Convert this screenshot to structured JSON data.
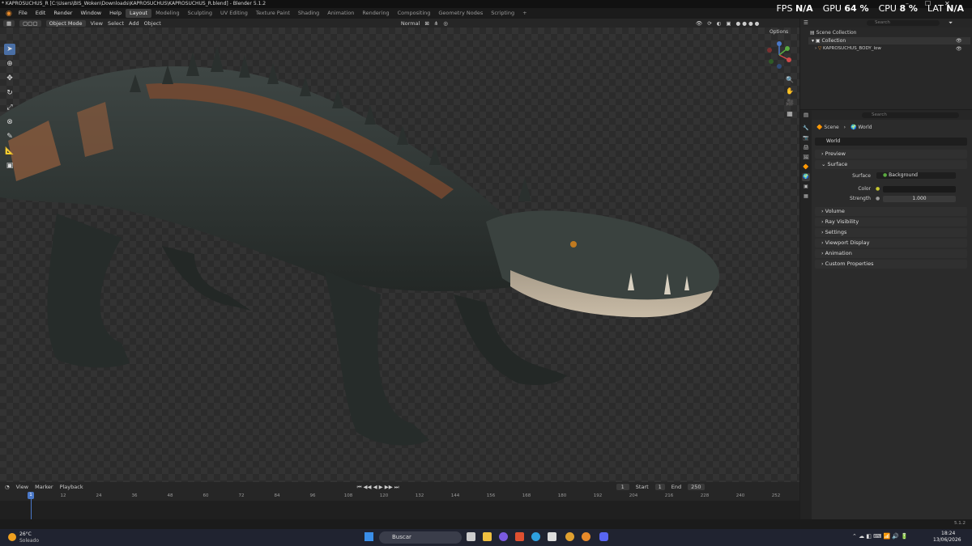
{
  "window": {
    "title": "* KAPROSUCHUS_R [C:\\Users\\BIS_Woken\\Downloads\\KAPROSUCHUS\\KAPROSUCHUS_R.blend] - Blender 5.1.2"
  },
  "menus": [
    "File",
    "Edit",
    "Render",
    "Window",
    "Help"
  ],
  "workspaces": [
    "Layout",
    "Modeling",
    "Sculpting",
    "UV Editing",
    "Texture Paint",
    "Shading",
    "Animation",
    "Rendering",
    "Compositing",
    "Geometry Nodes",
    "Scripting",
    "+"
  ],
  "active_workspace": "Layout",
  "overlay_stats": {
    "fps_label": "FPS",
    "fps_value": "N/A",
    "gpu_label": "GPU",
    "gpu_value": "64 %",
    "cpu_label": "CPU",
    "cpu_value": "8 %",
    "lat_label": "LAT",
    "lat_value": "N/A"
  },
  "viewport_header": {
    "mode": "Object Mode",
    "view": "View",
    "select": "Select",
    "add": "Add",
    "object": "Object",
    "orientation": "Normal",
    "options": "Options"
  },
  "timeline": {
    "view": "View",
    "marker": "Marker",
    "playback": "Playback",
    "current_frame": "1",
    "start_label": "Start",
    "start": "1",
    "end_label": "End",
    "end": "250",
    "ticks": [
      "12",
      "24",
      "36",
      "48",
      "60",
      "72",
      "84",
      "96",
      "108",
      "120",
      "132",
      "144",
      "156",
      "168",
      "180",
      "192",
      "204",
      "216",
      "228",
      "240",
      "252"
    ],
    "playhead": "1"
  },
  "status": {
    "version": "5.1.2"
  },
  "outliner": {
    "search_placeholder": "Search",
    "scene_collection": "Scene Collection",
    "collection": "Collection",
    "object": "KAPROSUCHUS_BODY_low"
  },
  "properties": {
    "search_placeholder": "Search",
    "breadcrumb_scene": "Scene",
    "breadcrumb_world": "World",
    "world_name": "World",
    "panels": {
      "preview": "Preview",
      "surface": "Surface",
      "volume": "Volume",
      "ray_visibility": "Ray Visibility",
      "settings": "Settings",
      "viewport_display": "Viewport Display",
      "animation": "Animation",
      "custom_properties": "Custom Properties"
    },
    "surface_label": "Surface",
    "surface_value": "Background",
    "color_label": "Color",
    "strength_label": "Strength",
    "strength_value": "1.000"
  },
  "taskbar": {
    "weather_temp": "26°C",
    "weather_desc": "Soleado",
    "search": "Buscar",
    "time": "18:24",
    "date": "13/06/2026"
  },
  "colors": {
    "accent": "#4a78c8",
    "active_workspace": "#3d3d3d",
    "background": "#1d1d1d"
  }
}
